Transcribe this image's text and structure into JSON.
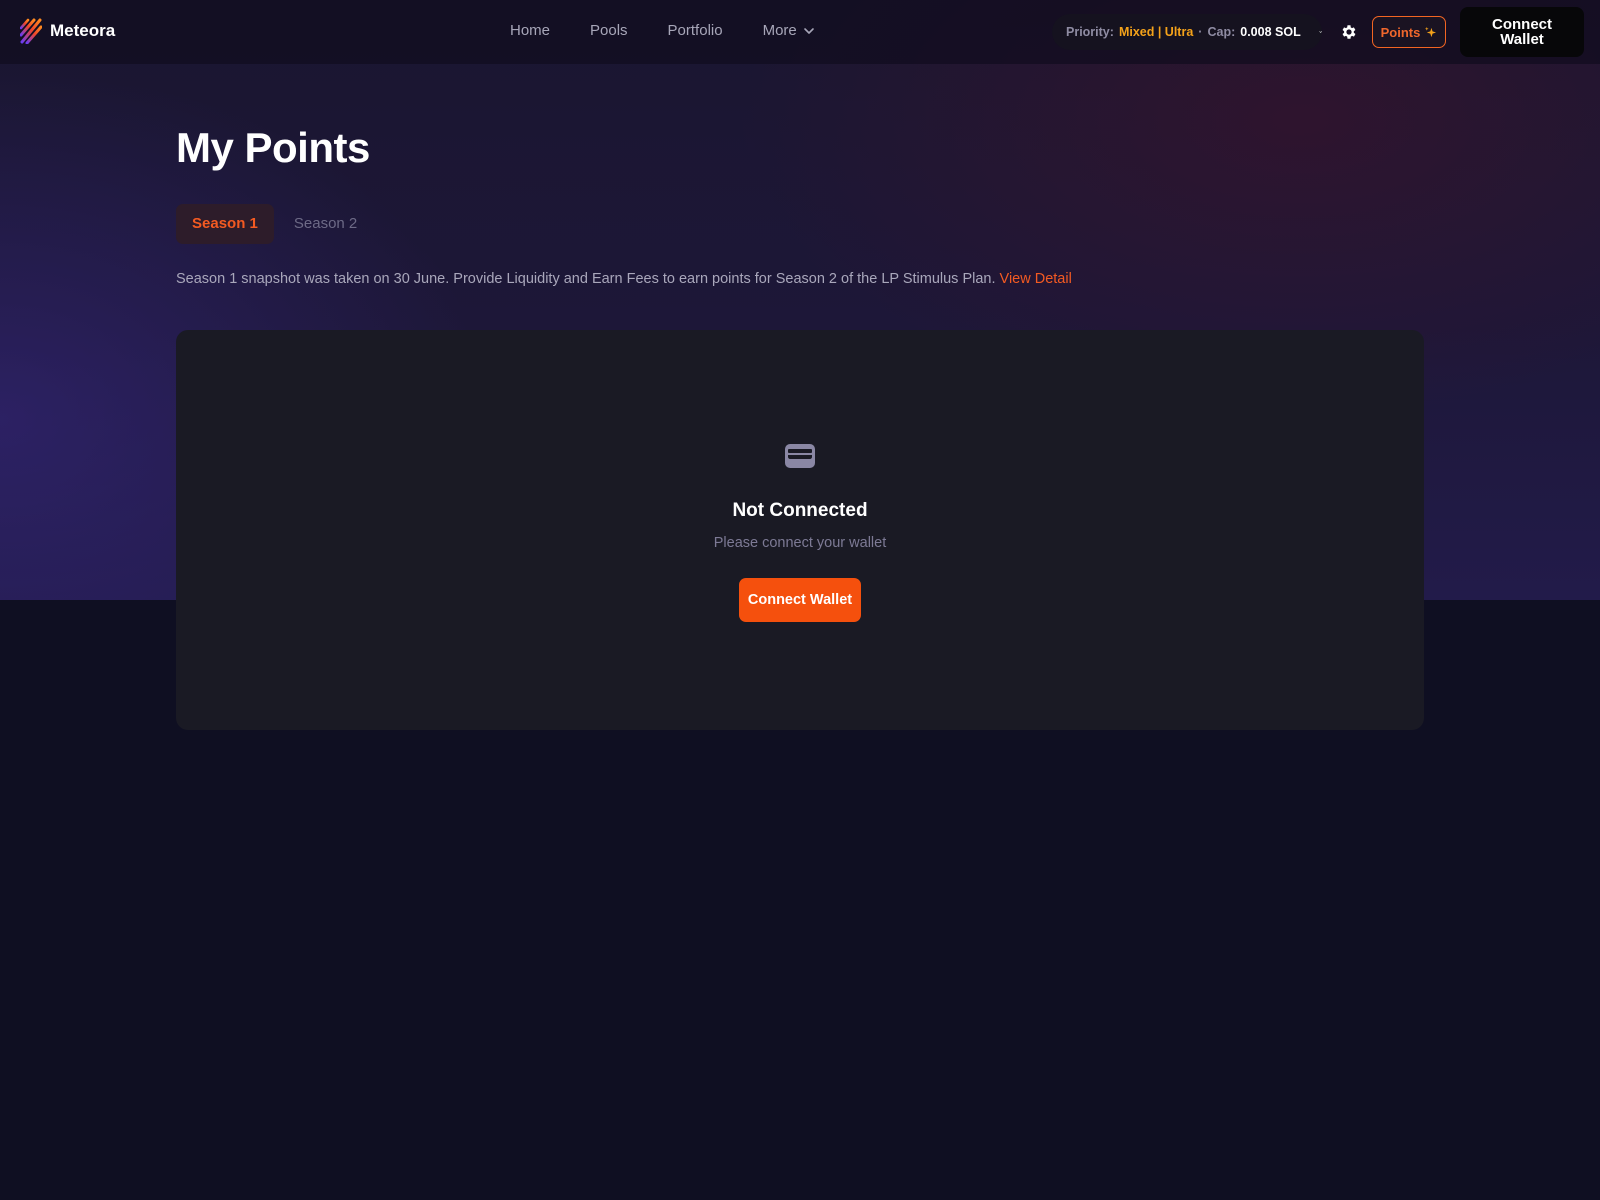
{
  "brand": {
    "name": "Meteora",
    "accent": "#f5500d"
  },
  "nav": {
    "items": [
      {
        "label": "Home"
      },
      {
        "label": "Pools"
      },
      {
        "label": "Portfolio"
      },
      {
        "label": "More"
      }
    ]
  },
  "priority": {
    "label": "Priority:",
    "mode": "Mixed | Ultra",
    "cap_label": "Cap:",
    "cap_value": "0.008 SOL"
  },
  "header": {
    "points_label": "Points",
    "connect_label": "Connect Wallet"
  },
  "main": {
    "title": "My Points",
    "tabs": [
      {
        "label": "Season 1",
        "active": true
      },
      {
        "label": "Season 2",
        "active": false
      }
    ],
    "description": "Season 1 snapshot was taken on 30 June. Provide Liquidity and Earn Fees to earn points for Season 2 of the LP Stimulus Plan.",
    "view_detail": "View Detail"
  },
  "empty_state": {
    "icon": "wallet-icon",
    "title": "Not Connected",
    "subtitle": "Please connect your wallet",
    "button": "Connect Wallet"
  }
}
